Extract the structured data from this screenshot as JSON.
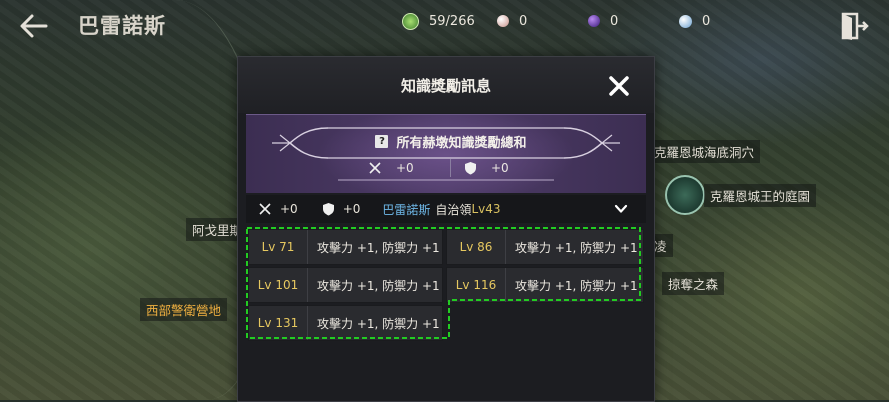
{
  "header": {
    "region_title": "巴雷諾斯",
    "currencies": [
      {
        "icon": "territory-token-icon",
        "value": "59/266",
        "color": "#5aa84a"
      },
      {
        "icon": "pearl-orb-icon",
        "value": "0",
        "color": "#d8b0a8"
      },
      {
        "icon": "purple-orb-icon",
        "value": "0",
        "color": "#6a3ab0"
      },
      {
        "icon": "blue-orb-icon",
        "value": "0",
        "color": "#8ac0e8"
      }
    ]
  },
  "map_labels": [
    {
      "text": "克羅恩城海底洞穴"
    },
    {
      "text": "克羅恩城王的庭園"
    },
    {
      "text": "阿戈里斯"
    },
    {
      "text": "西部警衛營地"
    },
    {
      "text": "掠奪之森"
    },
    {
      "text": "凌"
    }
  ],
  "modal": {
    "title": "知識獎勵訊息",
    "summary": {
      "title": "所有赫墩知識獎勵總和",
      "attack_bonus": "+0",
      "defense_bonus": "+0"
    },
    "territory": {
      "attack_bonus": "+0",
      "defense_bonus": "+0",
      "name": "巴雷諾斯",
      "kind": "自治領",
      "level": "Lv43"
    },
    "rewards": [
      {
        "level": "Lv 71",
        "bonus": "攻擊力 +1, 防禦力 +1"
      },
      {
        "level": "Lv 86",
        "bonus": "攻擊力 +1, 防禦力 +1"
      },
      {
        "level": "Lv 101",
        "bonus": "攻擊力 +1, 防禦力 +1"
      },
      {
        "level": "Lv 116",
        "bonus": "攻擊力 +1, 防禦力 +1"
      },
      {
        "level": "Lv 131",
        "bonus": "攻擊力 +1, 防禦力 +1"
      }
    ],
    "highlight_color": "#22cc22"
  }
}
